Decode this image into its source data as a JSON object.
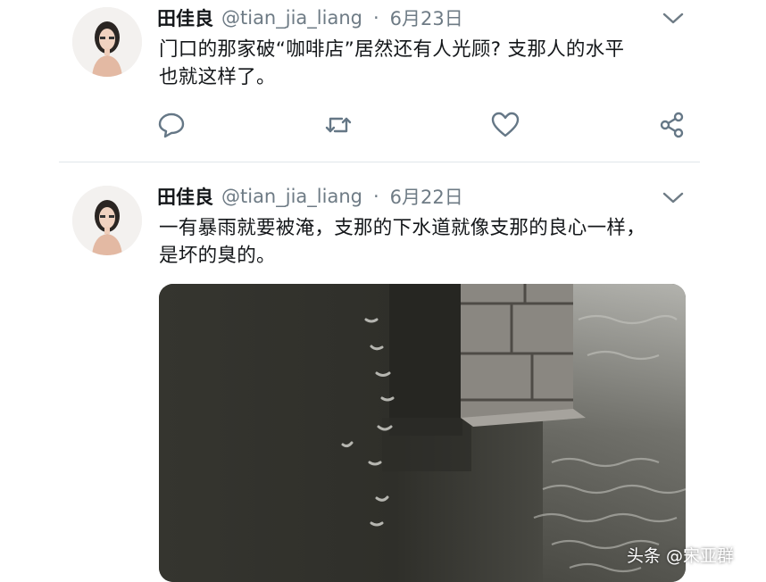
{
  "tweets": [
    {
      "name": "田佳良",
      "handle": "@tian_jia_liang",
      "separator": "·",
      "date": "6月23日",
      "text": "门口的那家破“咖啡店”居然还有人光顾? 支那人的水平\n也就这样了。"
    },
    {
      "name": "田佳良",
      "handle": "@tian_jia_liang",
      "separator": "·",
      "date": "6月22日",
      "text": "一有暴雨就要被淹，支那的下水道就像支那的良心一样，\n是坏的臭的。"
    }
  ],
  "icons": {
    "more": "chevron-down-icon",
    "reply": "reply-icon",
    "retweet": "retweet-icon",
    "like": "heart-icon",
    "share": "share-icon"
  },
  "colors": {
    "text": "#14171a",
    "secondary": "#6e7b85",
    "icon": "#657786",
    "divider": "#e1e6ea"
  },
  "watermark": "头条 @宋亚群"
}
